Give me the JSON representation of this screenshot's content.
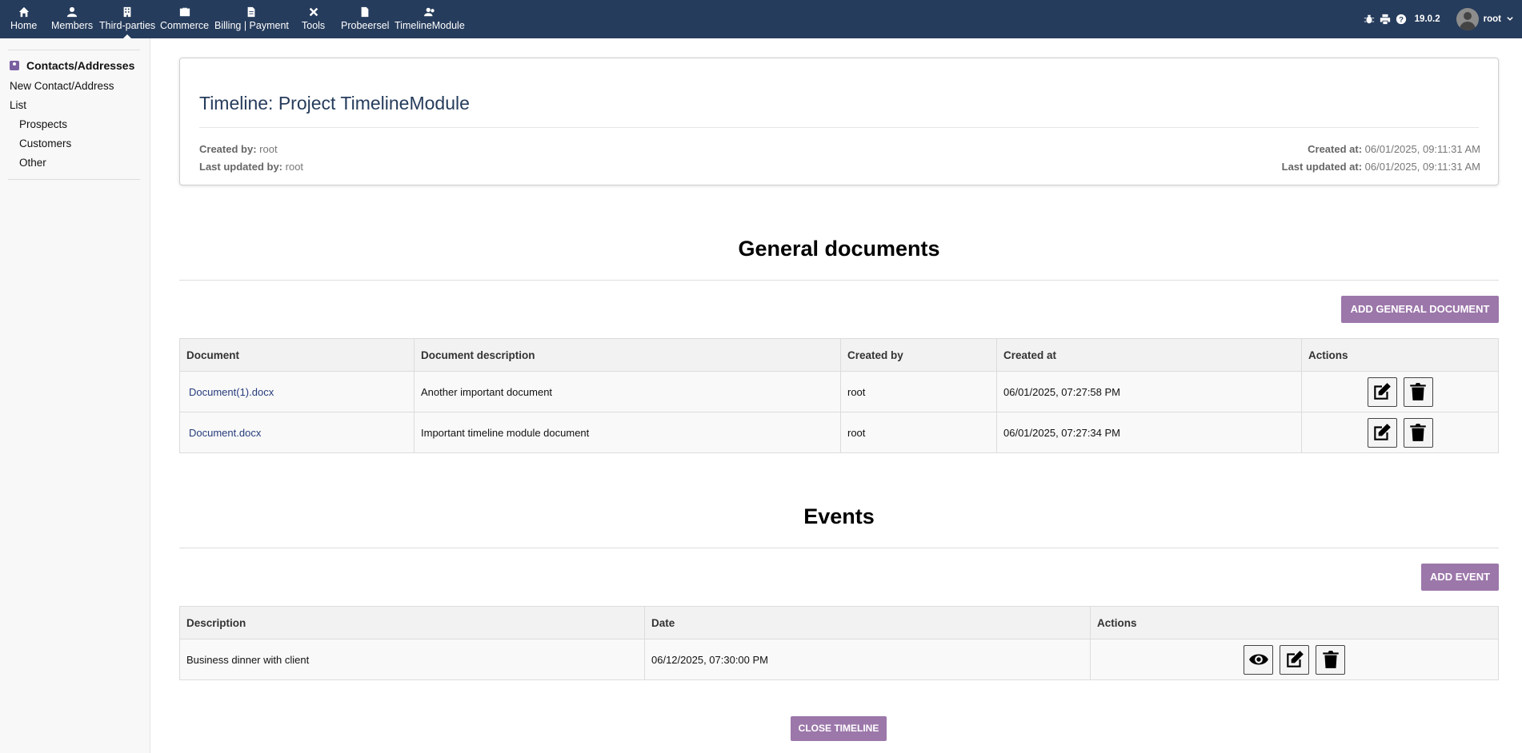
{
  "topnav": {
    "items": [
      {
        "label": "Home",
        "icon": "home-icon"
      },
      {
        "label": "Members",
        "icon": "user-icon"
      },
      {
        "label": "Third-parties",
        "icon": "building-icon"
      },
      {
        "label": "Commerce",
        "icon": "suitcase-icon"
      },
      {
        "label": "Billing | Payment",
        "icon": "file-invoice-icon"
      },
      {
        "label": "Tools",
        "icon": "tools-icon"
      },
      {
        "label": "Probeersel",
        "icon": "file-icon"
      },
      {
        "label": "TimelineModule",
        "icon": "user-group-icon"
      }
    ],
    "active": "Third-parties",
    "version": "19.0.2",
    "user": "root"
  },
  "sidebar": {
    "heading": "Contacts/Addresses",
    "new_link": "New Contact/Address",
    "list_link": "List",
    "sub_items": [
      "Prospects",
      "Customers",
      "Other"
    ]
  },
  "card": {
    "title": "Timeline: Project TimelineModule",
    "created_by_label": "Created by:",
    "created_by": "root",
    "last_updated_by_label": "Last updated by:",
    "last_updated_by": "root",
    "created_at_label": "Created at:",
    "created_at": "06/01/2025, 09:11:31 AM",
    "last_updated_at_label": "Last updated at:",
    "last_updated_at": "06/01/2025, 09:11:31 AM"
  },
  "documents": {
    "title": "General documents",
    "add_button": "ADD GENERAL DOCUMENT",
    "columns": [
      "Document",
      "Document description",
      "Created by",
      "Created at",
      "Actions"
    ],
    "rows": [
      {
        "document": "Document(1).docx",
        "description": "Another important document",
        "created_by": "root",
        "created_at": "06/01/2025, 07:27:58 PM"
      },
      {
        "document": "Document.docx",
        "description": "Important timeline module document",
        "created_by": "root",
        "created_at": "06/01/2025, 07:27:34 PM"
      }
    ]
  },
  "events": {
    "title": "Events",
    "add_button": "ADD EVENT",
    "columns": [
      "Description",
      "Date",
      "Actions"
    ],
    "rows": [
      {
        "description": "Business dinner with client",
        "date": "06/12/2025, 07:30:00 PM"
      }
    ]
  },
  "close_button": "CLOSE TIMELINE",
  "colors": {
    "topbar": "#263c5c",
    "accent": "#9c77aa",
    "title": "#263c5c"
  }
}
